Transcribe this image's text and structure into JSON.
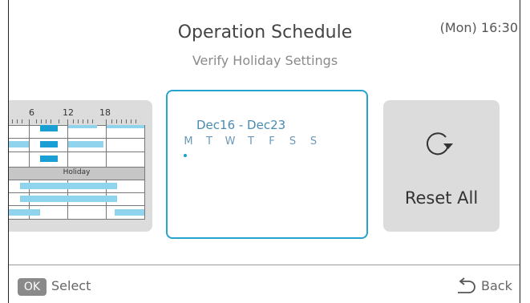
{
  "header": {
    "title": "Operation Schedule",
    "subtitle": "Verify Holiday Settings",
    "clock": "(Mon) 16:30"
  },
  "schedule_preview": {
    "hour_labels": [
      "6",
      "12",
      "18"
    ],
    "holiday_label": "Holiday"
  },
  "selected_card": {
    "range": "Dec16 - Dec23",
    "days": [
      "M",
      "T",
      "W",
      "T",
      "F",
      "S",
      "S"
    ],
    "marked_day_index": 0
  },
  "reset_card": {
    "label": "Reset All",
    "icon": "refresh-icon"
  },
  "footer": {
    "ok_badge": "OK",
    "ok_label": "Select",
    "back_label": "Back",
    "back_icon": "back-arrow-icon"
  },
  "colors": {
    "accent": "#26a3cf",
    "bar_light": "#8fd3ec",
    "bar_dark": "#1a9fd4",
    "card_bg": "#dcdcdc"
  }
}
